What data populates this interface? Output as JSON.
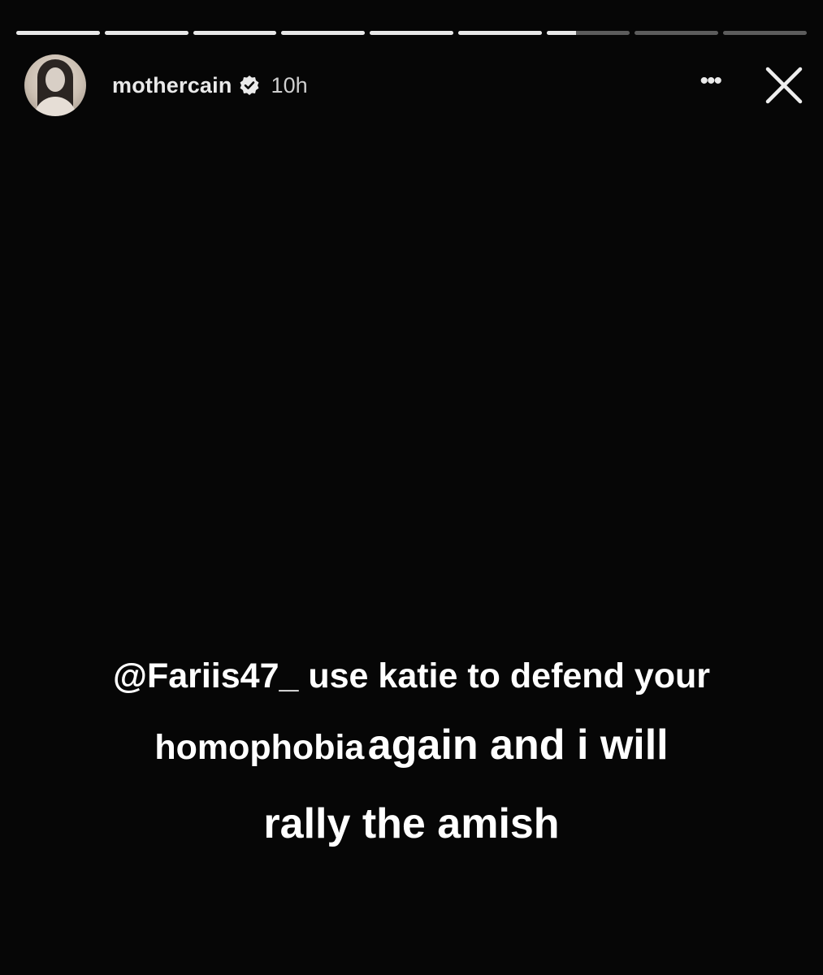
{
  "progress": {
    "segments": [
      1,
      1,
      1,
      1,
      1,
      1,
      0.35,
      0,
      0
    ]
  },
  "header": {
    "username": "mothercain",
    "timestamp": "10h",
    "more_label": "•••",
    "icons": {
      "verified": "verified-badge-icon",
      "more": "more-options-icon",
      "close": "close-icon"
    }
  },
  "caption": {
    "line1": "@Fariis47_ use katie to defend your",
    "line2_a": "homophobia",
    "line2_b": "again and i will",
    "line3": "rally the amish"
  },
  "colors": {
    "background": "#060606",
    "text": "#ffffff",
    "progress_fill": "#e8e8e8"
  }
}
